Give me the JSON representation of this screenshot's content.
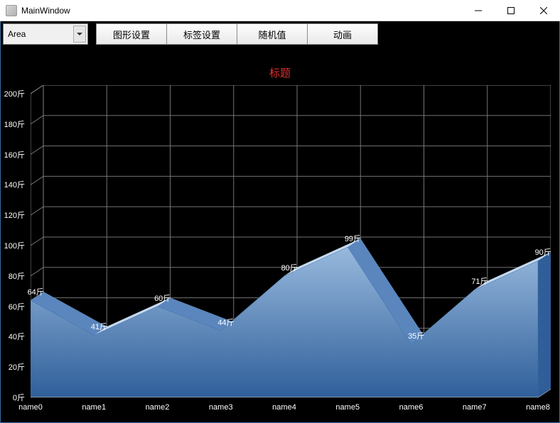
{
  "window": {
    "title": "MainWindow"
  },
  "toolbar": {
    "combo_value": "Area",
    "btn_shape": "图形设置",
    "btn_label": "标签设置",
    "btn_random": "随机值",
    "btn_anim": "动画"
  },
  "chart_data": {
    "type": "area",
    "title": "标题",
    "categories": [
      "name0",
      "name1",
      "name2",
      "name3",
      "name4",
      "name5",
      "name6",
      "name7",
      "name8"
    ],
    "values": [
      64,
      41,
      60,
      44,
      80,
      99,
      35,
      71,
      90
    ],
    "value_unit": "斤",
    "ylim": [
      0,
      200
    ],
    "yticks": [
      0,
      20,
      40,
      60,
      80,
      100,
      120,
      140,
      160,
      180,
      200
    ],
    "ytick_unit": "斤",
    "xlabel": "",
    "ylabel": "",
    "series": [
      {
        "name": "",
        "values": [
          64,
          41,
          60,
          44,
          80,
          99,
          35,
          71,
          90
        ]
      }
    ],
    "colors": {
      "area_front_top": "#98b9dd",
      "area_front_bottom": "#2f5f9a",
      "area_top_light": "#c4d8ee",
      "area_top_dark": "#5a86bd",
      "grid": "#808080",
      "grid_base": "#b8b8b8",
      "floor": "#202020",
      "title": "#e03030",
      "text": "#ffffff"
    }
  }
}
